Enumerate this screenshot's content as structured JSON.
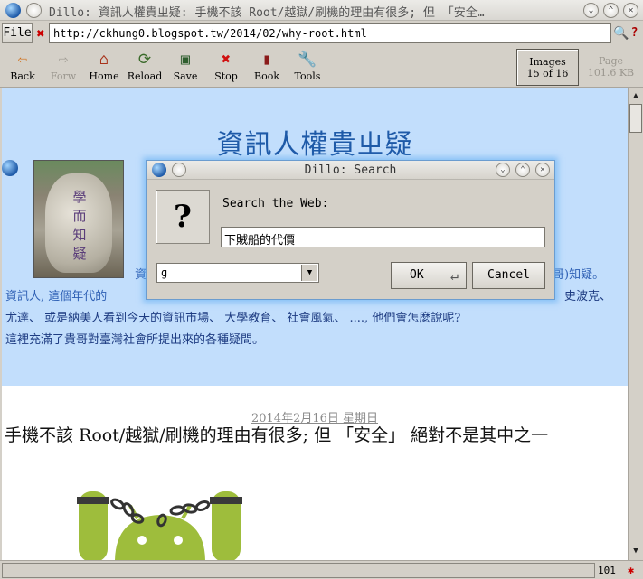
{
  "window": {
    "title": "Dillo: 資訊人權貴ㄓ疑: 手機不該 Root/越獄/刷機的理由有很多; 但 「安全…",
    "minimize_icon": "⌄",
    "maximize_icon": "⌃",
    "close_icon": "✕"
  },
  "urlbar": {
    "file_label": "File",
    "clear_icon": "✖",
    "url": "http://ckhung0.blogspot.tw/2014/02/why-root.html",
    "search_icon": "🔍",
    "help_icon": "?"
  },
  "toolbar": {
    "back": "Back",
    "forward": "Forw",
    "home": "Home",
    "reload": "Reload",
    "save": "Save",
    "stop": "Stop",
    "book": "Book",
    "tools": "Tools",
    "images_label": "Images",
    "images_count": "15 of 16",
    "page_label": "Page",
    "page_size": "101.6 KB"
  },
  "page": {
    "blog_title": "資訊人權貴ㄓ疑",
    "rock_engraving": "學而知疑",
    "intro_line1_start": "資",
    "intro_line1_end": "哥)知疑。",
    "intro_line2_start": "資訊人, 這個年代的",
    "intro_line2_end": "史波克、",
    "intro_line3": "尤達、 或是納美人看到今天的資訊市場、 大學教育、 社會風氣、 ...., 他們會怎麼說呢?",
    "intro_line4": "這裡充滿了貴哥對臺灣社會所提出來的各種疑問。",
    "post_date": "2014年2月16日 星期日",
    "post_title": "手機不該 Root/越獄/刷機的理由有很多; 但 「安全」 絕對不是其中之一"
  },
  "statusbar": {
    "status_text": "",
    "count": "101",
    "bug_icon": "✱"
  },
  "dialog": {
    "title": "Dillo: Search",
    "question_icon": "?",
    "label": "Search the Web:",
    "query": "下賊船的代價",
    "engine": "g",
    "ok_label": "OK",
    "enter_icon": "↵",
    "cancel_label": "Cancel"
  }
}
